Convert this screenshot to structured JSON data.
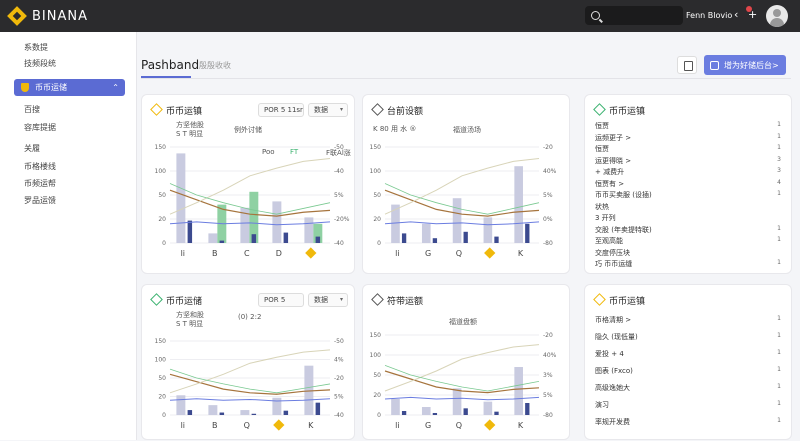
{
  "app": {
    "title": "BINANA",
    "user_name": "Fenn Blovio"
  },
  "colors": {
    "accent": "#5b6bd3",
    "brand": "#f0b90b",
    "topbar": "#2b2b2d",
    "green": "#3bb26f",
    "navy": "#3c4a8f",
    "brown": "#a6743d"
  },
  "sidebar": {
    "items": [
      {
        "label": "系数提"
      },
      {
        "label": "技频段统"
      },
      {
        "label": "币币运储",
        "active": true
      },
      {
        "label": "百搜"
      },
      {
        "label": "容库提据"
      },
      {
        "label": "关履"
      },
      {
        "label": "币格楼线"
      },
      {
        "label": "币频运帮"
      },
      {
        "label": "罗品运馈"
      }
    ]
  },
  "header": {
    "title": "Pashband",
    "subtitle": "殷殷收收",
    "primary_button": "增为好储后台>"
  },
  "cards": [
    {
      "title": "币币运镇",
      "select_a": "POR 5 11sr",
      "select_b": "数据",
      "note_a": "方坚他股",
      "note_b": "S T 明显",
      "center_note": "例外讨储",
      "legend": [
        "Poo",
        "FT",
        "F联Al涨"
      ],
      "y_left": [
        "150",
        "100",
        "50",
        "20",
        "0"
      ],
      "y_right": [
        "-50",
        "-40",
        "5%",
        "-20%",
        "-40"
      ],
      "x_labels": [
        "li",
        "B",
        "C",
        "D",
        ""
      ]
    },
    {
      "title": "台前设额",
      "note_a": "K 80 用 水 ®",
      "center_note": "福道汤场",
      "y_left": [
        "150",
        "100",
        "50",
        "20",
        "0"
      ],
      "y_right": [
        "-20",
        "40%",
        "5%",
        "0%",
        "-80"
      ],
      "x_labels": [
        "li",
        "G",
        "Q",
        "",
        "K"
      ]
    },
    {
      "title": "币币运镇",
      "items": [
        {
          "label": "恒贾",
          "num": "1"
        },
        {
          "label": "运频更子 >",
          "num": "1"
        },
        {
          "label": "恒贾",
          "num": "1"
        },
        {
          "label": "运更得晓 >",
          "num": "3"
        },
        {
          "label": "+ 减费升",
          "num": "3"
        },
        {
          "label": "恒贾有 >",
          "num": "4"
        },
        {
          "label": "币币买卖服 (设插)",
          "num": "1"
        },
        {
          "label": "状热",
          "num": ""
        },
        {
          "label": "3 开列",
          "num": ""
        },
        {
          "label": "交股 (年卖提特联)",
          "num": "1"
        },
        {
          "label": "至观高能",
          "num": "1"
        },
        {
          "label": "交度停压块",
          "num": ""
        },
        {
          "label": "巧 币币运缝",
          "num": "1"
        }
      ]
    },
    {
      "title": "币币运储",
      "select_a": "POR 5",
      "select_b": "数据",
      "note_a": "方坚和股",
      "note_b": "S T 明显",
      "center_note": "(0) 2:2",
      "y_left": [
        "150",
        "100",
        "50",
        "20",
        "0"
      ],
      "y_right": [
        "-50",
        "4%",
        "-20",
        "5%",
        "-40"
      ],
      "x_labels": [
        "li",
        "B",
        "Q",
        "",
        "K"
      ]
    },
    {
      "title": "符带运额",
      "center_note": "福道盘额",
      "y_left": [
        "150",
        "100",
        "50",
        "20",
        "0"
      ],
      "y_right": [
        "-20",
        "40%",
        "3%",
        "5%",
        "-80"
      ],
      "x_labels": [
        "li",
        "G",
        "Q",
        "",
        "K"
      ]
    },
    {
      "title": "币币运镇",
      "items": [
        {
          "label": "币格清期 >",
          "num": "1"
        },
        {
          "label": "隐久 (现低量)",
          "num": "1"
        },
        {
          "label": "爱投 + 4",
          "num": "1"
        },
        {
          "label": "图表 (Fxco)",
          "num": "1"
        },
        {
          "label": "高级逸她大",
          "num": "1"
        },
        {
          "label": "演习",
          "num": "1"
        },
        {
          "label": "率规开发费",
          "num": "1"
        }
      ]
    }
  ],
  "chart_data": [
    {
      "type": "bar",
      "categories": [
        "li",
        "B",
        "C",
        "D",
        ""
      ],
      "series": [
        {
          "name": "Poo",
          "values": [
            140,
            15,
            55,
            65,
            40
          ]
        },
        {
          "name": "FT",
          "values": [
            0,
            60,
            80,
            0,
            30
          ]
        }
      ],
      "ylim": [
        0,
        150
      ]
    },
    {
      "type": "bar",
      "categories": [
        "li",
        "G",
        "Q",
        "",
        "K"
      ],
      "series": [
        {
          "values": [
            60,
            30,
            70,
            40,
            120
          ]
        }
      ],
      "ylim": [
        0,
        150
      ]
    },
    {
      "type": "bar",
      "categories": [
        "li",
        "B",
        "Q",
        "",
        "K"
      ],
      "series": [
        {
          "values": [
            40,
            20,
            10,
            35,
            100
          ]
        }
      ],
      "ylim": [
        0,
        150
      ]
    },
    {
      "type": "bar",
      "categories": [
        "li",
        "G",
        "Q",
        "",
        "K"
      ],
      "series": [
        {
          "values": [
            30,
            15,
            50,
            25,
            90
          ]
        }
      ],
      "ylim": [
        0,
        150
      ]
    }
  ]
}
